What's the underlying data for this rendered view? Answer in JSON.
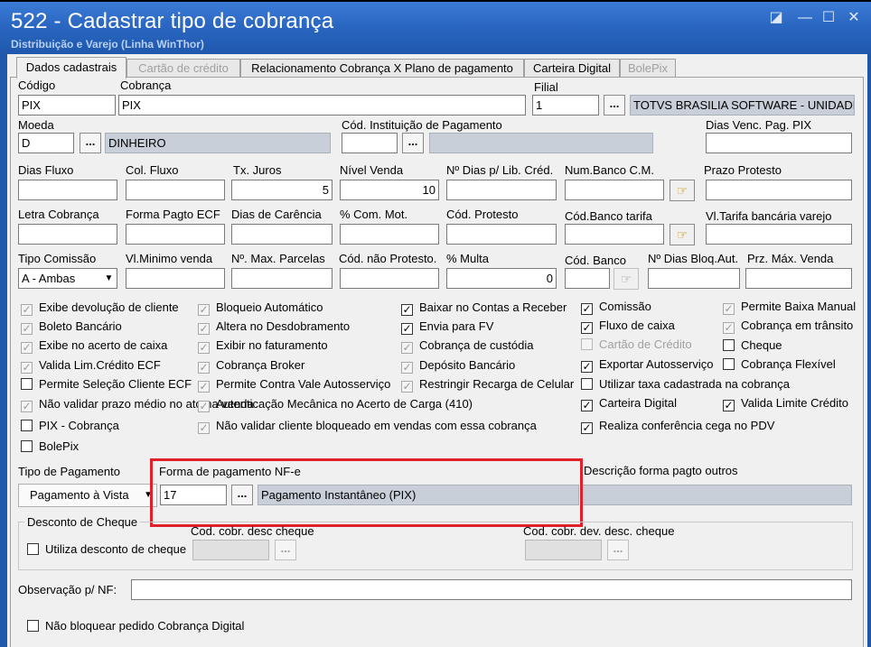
{
  "window": {
    "title": "522 - Cadastrar tipo de cobrança",
    "subtitle": "Distribuição e Varejo (Linha WinThor)"
  },
  "tabs": [
    {
      "label": "Dados cadastrais",
      "state": "active"
    },
    {
      "label": "Cartão de crédito",
      "state": "disabled"
    },
    {
      "label": "Relacionamento Cobrança X Plano de pagamento",
      "state": "normal"
    },
    {
      "label": "Carteira Digital",
      "state": "normal"
    },
    {
      "label": "BolePix",
      "state": "disabled"
    }
  ],
  "fields": {
    "codigo": {
      "label": "Código",
      "value": "PIX"
    },
    "cobranca": {
      "label": "Cobrança",
      "value": "PIX"
    },
    "filial": {
      "label": "Filial",
      "value": "1",
      "description": "TOTVS BRASILIA SOFTWARE - UNIDADE"
    },
    "moeda": {
      "label": "Moeda",
      "value": "D",
      "description": "DINHEIRO"
    },
    "cod_instituicao": {
      "label": "Cód. Instituição de Pagamento",
      "value": "",
      "description": ""
    },
    "dias_venc_pag_pix": {
      "label": "Dias Venc. Pag. PIX",
      "value": ""
    },
    "dias_fluxo": {
      "label": "Dias Fluxo",
      "value": ""
    },
    "col_fluxo": {
      "label": "Col. Fluxo",
      "value": ""
    },
    "tx_juros": {
      "label": "Tx. Juros",
      "value": "5"
    },
    "nivel_venda": {
      "label": "Nível Venda",
      "value": "10"
    },
    "n_dias_lib_cred": {
      "label": "Nº Dias p/ Lib. Créd.",
      "value": ""
    },
    "num_banco_cm": {
      "label": "Num.Banco C.M.",
      "value": ""
    },
    "prazo_protesto": {
      "label": "Prazo Protesto",
      "value": ""
    },
    "letra_cobranca": {
      "label": "Letra Cobrança",
      "value": ""
    },
    "forma_pagto_ecf": {
      "label": "Forma Pagto ECF",
      "value": ""
    },
    "dias_carencia": {
      "label": "Dias de Carência",
      "value": ""
    },
    "pct_com_mot": {
      "label": "% Com. Mot.",
      "value": ""
    },
    "cod_protesto": {
      "label": "Cód. Protesto",
      "value": ""
    },
    "cod_banco_tarifa": {
      "label": "Cód.Banco tarifa",
      "value": ""
    },
    "vl_tarifa_bancaria": {
      "label": "Vl.Tarifa bancária varejo",
      "value": ""
    },
    "tipo_comissao": {
      "label": "Tipo Comissão",
      "value": "A - Ambas"
    },
    "vl_minimo_venda": {
      "label": "Vl.Minimo venda",
      "value": ""
    },
    "n_max_parcelas": {
      "label": "Nº. Max. Parcelas",
      "value": ""
    },
    "cod_nao_protesto": {
      "label": "Cód. não Protesto.",
      "value": ""
    },
    "pct_multa": {
      "label": "% Multa",
      "value": "0"
    },
    "cod_banco": {
      "label": "Cód. Banco",
      "value": ""
    },
    "n_dias_bloq_aut": {
      "label": "Nº Dias Bloq.Aut.",
      "value": ""
    },
    "prz_max_venda": {
      "label": "Prz. Máx. Venda",
      "value": ""
    }
  },
  "checkboxes": {
    "col1": [
      {
        "label": "Exibe devolução de cliente",
        "checked": true,
        "style": "gray"
      },
      {
        "label": "Boleto Bancário",
        "checked": true,
        "style": "gray"
      },
      {
        "label": "Exibe no acerto de caixa",
        "checked": true,
        "style": "gray"
      },
      {
        "label": "Valida Lim.Crédito ECF",
        "checked": true,
        "style": "gray"
      },
      {
        "label": "Permite Seleção Cliente ECF",
        "checked": false,
        "style": "normal"
      },
      {
        "label": "Não validar prazo médio no ato na venda",
        "checked": true,
        "style": "gray"
      },
      {
        "label": "PIX - Cobrança",
        "checked": false,
        "style": "normal"
      },
      {
        "label": "BolePix",
        "checked": false,
        "style": "normal"
      }
    ],
    "col2": [
      {
        "label": "Bloqueio Automático",
        "checked": true,
        "style": "gray"
      },
      {
        "label": "Altera no Desdobramento",
        "checked": true,
        "style": "gray"
      },
      {
        "label": "Exibir no faturamento",
        "checked": true,
        "style": "gray"
      },
      {
        "label": "Cobrança Broker",
        "checked": true,
        "style": "gray"
      },
      {
        "label": "Permite Contra Vale Autosserviço",
        "checked": true,
        "style": "gray"
      },
      {
        "label": "Autenticação Mecânica no Acerto de Carga (410)",
        "checked": true,
        "style": "gray"
      },
      {
        "label": "Não validar cliente bloqueado em vendas com essa cobrança",
        "checked": true,
        "style": "gray"
      }
    ],
    "col3": [
      {
        "label": "Baixar no Contas a Receber",
        "checked": true,
        "style": "normal"
      },
      {
        "label": "Envia para FV",
        "checked": true,
        "style": "normal"
      },
      {
        "label": "Cobrança de custódia",
        "checked": true,
        "style": "gray"
      },
      {
        "label": "Depósito Bancário",
        "checked": true,
        "style": "gray"
      },
      {
        "label": "Restringir Recarga de Celular",
        "checked": true,
        "style": "gray"
      }
    ],
    "col4": [
      {
        "label": "Comissão",
        "checked": true,
        "style": "normal"
      },
      {
        "label": "Fluxo de caixa",
        "checked": true,
        "style": "normal"
      },
      {
        "label": "Cartão de Crédito",
        "checked": false,
        "style": "disabled"
      },
      {
        "label": "Exportar Autosserviço",
        "checked": true,
        "style": "normal"
      },
      {
        "label": "Utilizar taxa cadastrada na cobrança",
        "checked": false,
        "style": "normal"
      },
      {
        "label": "Carteira Digital",
        "checked": true,
        "style": "normal"
      },
      {
        "label": "Realiza conferência cega no PDV",
        "checked": true,
        "style": "normal"
      }
    ],
    "col5": [
      {
        "label": "Permite Baixa Manual",
        "checked": true,
        "style": "gray"
      },
      {
        "label": "Cobrança em trânsito",
        "checked": true,
        "style": "gray"
      },
      {
        "label": "Cheque",
        "checked": false,
        "style": "normal"
      },
      {
        "label": "Cobrança Flexível",
        "checked": false,
        "style": "normal"
      },
      {
        "label": "Valida Limite Crédito",
        "checked": true,
        "style": "normal"
      }
    ]
  },
  "tipo_pagamento": {
    "label": "Tipo de Pagamento",
    "value": "Pagamento à Vista"
  },
  "forma_pagamento_nfe": {
    "label": "Forma de pagamento NF-e",
    "value": "17",
    "description": "Pagamento Instantâneo (PIX)"
  },
  "descricao_forma_outros": {
    "label": "Descrição forma pagto outros",
    "value": ""
  },
  "desconto_cheque": {
    "group_label": "Desconto de Cheque",
    "utiliza_label": "Utiliza desconto de cheque",
    "utiliza_checked": false,
    "cod_cobr_desc_label": "Cod. cobr. desc cheque",
    "cod_cobr_dev_label": "Cod. cobr. dev. desc. cheque"
  },
  "observacao": {
    "label": "Observação p/ NF:",
    "value": ""
  },
  "nao_bloquear": {
    "label": "Não bloquear pedido Cobrança Digital",
    "checked": false
  },
  "ellipsis": "...",
  "hand_glyph": "☞",
  "colors": {
    "titlebar": "#2a67c2",
    "highlight": "#e0202a",
    "readonly_field": "#c8cfd8"
  }
}
